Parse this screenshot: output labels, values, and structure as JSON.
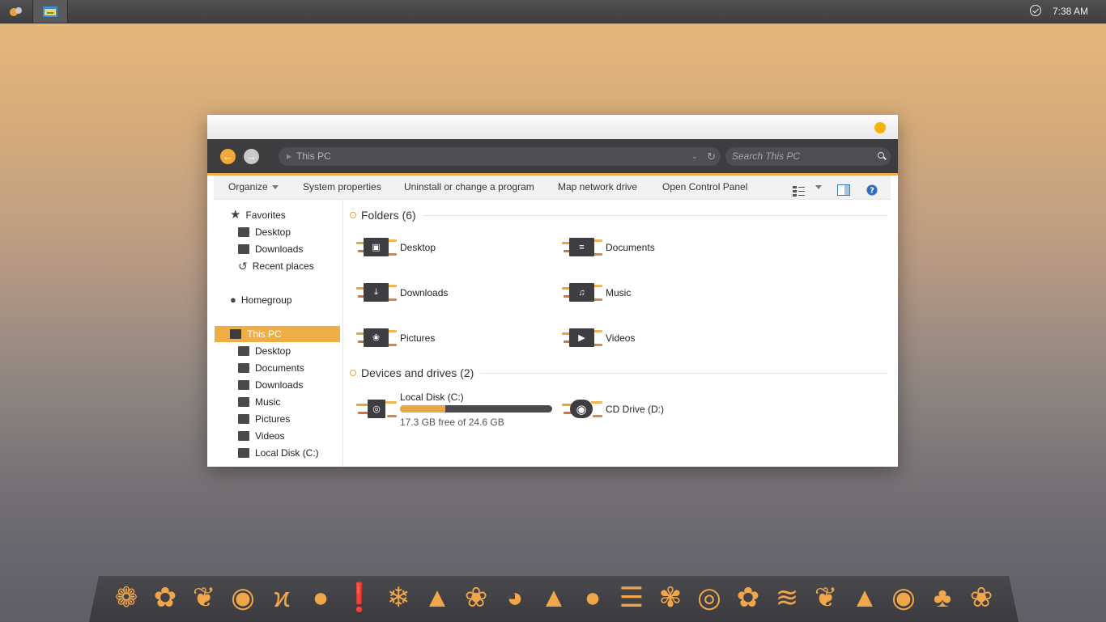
{
  "taskbar": {
    "clock": "7:38 AM"
  },
  "window": {
    "address": "This PC",
    "search_placeholder": "Search This PC",
    "toolbar": {
      "organize": "Organize",
      "system_properties": "System properties",
      "uninstall": "Uninstall or change a program",
      "map_drive": "Map network drive",
      "control_panel": "Open Control Panel"
    },
    "sidebar": {
      "favorites": "Favorites",
      "fav_desktop": "Desktop",
      "fav_downloads": "Downloads",
      "fav_recent": "Recent places",
      "homegroup": "Homegroup",
      "this_pc": "This PC",
      "pc_desktop": "Desktop",
      "pc_documents": "Documents",
      "pc_downloads": "Downloads",
      "pc_music": "Music",
      "pc_pictures": "Pictures",
      "pc_videos": "Videos",
      "pc_local_disk": "Local Disk (C:)"
    },
    "folders_title": "Folders (6)",
    "folders": {
      "desktop": "Desktop",
      "documents": "Documents",
      "downloads": "Downloads",
      "music": "Music",
      "pictures": "Pictures",
      "videos": "Videos"
    },
    "devices_title": "Devices and drives (2)",
    "drives": {
      "c_name": "Local Disk (C:)",
      "c_free": "17.3 GB free of 24.6 GB",
      "c_used_fraction": 0.297,
      "d_name": "CD Drive (D:)"
    }
  },
  "colors": {
    "accent": "#efad46",
    "dark": "#3d3d40"
  }
}
